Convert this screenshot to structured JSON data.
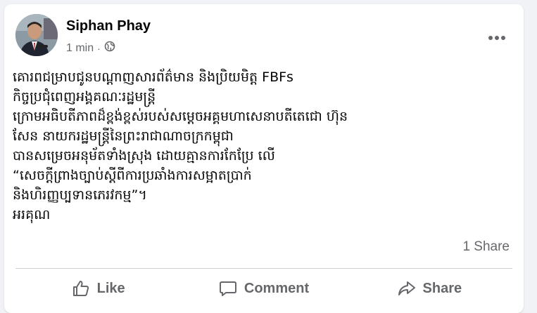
{
  "post": {
    "author": {
      "name": "Siphan Phay"
    },
    "timestamp": "1 min",
    "separator": "·",
    "audience_icon": "globe-icon",
    "menu_icon": "more-horizontal-icon",
    "body_lines": [
      "គោរពជម្រាបជូនបណ្ដាញសារព័ត៌មាន និងប្រិយមិត្ត FBFs",
      "កិច្ចប្រជុំពេញអង្គគណៈរដ្ឋមន្ត្រី",
      "ក្រោមអធិបតីភាពដ៏ខ្ពង់ខ្ពស់របស់សម្ដេចអគ្គមហាសេនាបតីតេជោ ហ៊ុន",
      "សែន នាយករដ្ឋមន្ត្រីនៃព្រះរាជាណាចក្រកម្ពុជា",
      "បានសម្រេចអនុម័តទាំងស្រុង ដោយគ្មានការកែប្រែ លើ",
      "“សេចក្ដីព្រាងច្បាប់ស្ដីពីការប្រឆាំងការសម្អាតប្រាក់",
      "និងហិរញ្ញប្បទានភេរវកម្ម”។",
      "អរគុណ"
    ],
    "share_count": "1 Share"
  },
  "actions": {
    "like": {
      "label": "Like",
      "icon": "thumbs-up-icon"
    },
    "comment": {
      "label": "Comment",
      "icon": "comment-icon"
    },
    "share": {
      "label": "Share",
      "icon": "share-icon"
    }
  },
  "colors": {
    "background": "#f0f2f5",
    "card": "#ffffff",
    "primary_text": "#050505",
    "secondary_text": "#65676b",
    "divider": "#ced0d4"
  }
}
